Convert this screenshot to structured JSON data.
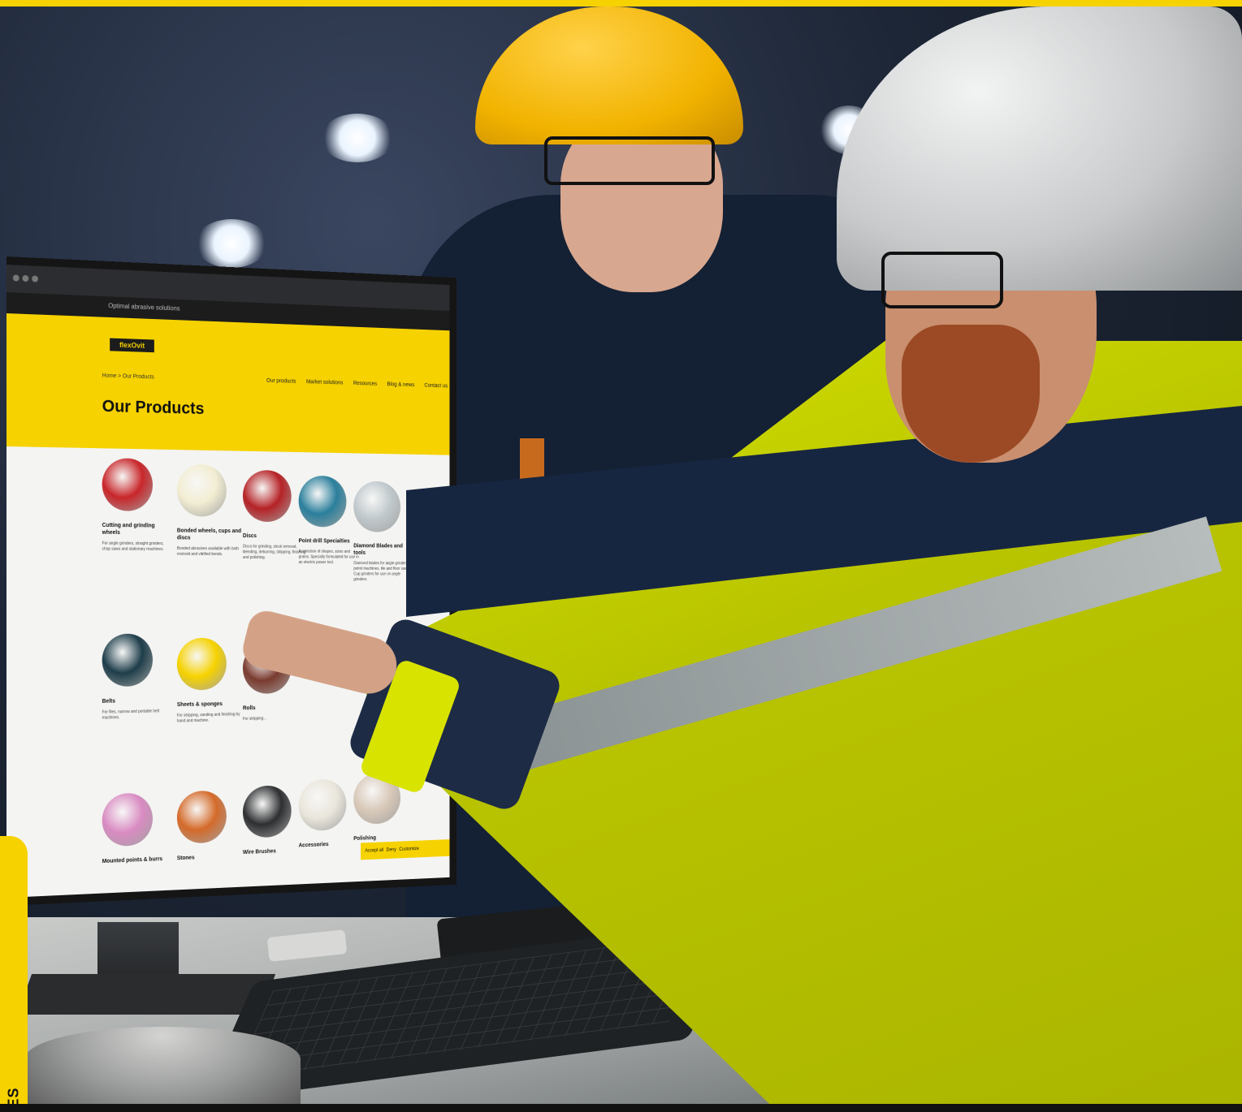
{
  "side_tab": {
    "text": "DES",
    "color": "#f6d200"
  },
  "colors": {
    "brand_yellow": "#f6d200",
    "jacket_navy": "#172640",
    "hi_vis": "#d6e200"
  },
  "screen": {
    "tagline": "Optimal abrasive solutions",
    "logo": "flexOvit",
    "breadcrumb": "Home > Our Products",
    "page_title": "Our Products",
    "nav": [
      "Our products",
      "Market solutions",
      "Resources",
      "Blog & news",
      "Contact us"
    ],
    "products": [
      {
        "name": "Cutting and grinding wheels",
        "desc": "For angle grinders, straight grinders, chop saws and stationary machines.",
        "color": "#c8262a"
      },
      {
        "name": "Bonded wheels, cups and discs",
        "desc": "Bonded abrasives available with both resinoid and vitrified bonds.",
        "color": "#f2edd2"
      },
      {
        "name": "Discs",
        "desc": "Discs for grinding, stock removal, blending, deburring, stripping, finishing and polishing.",
        "color": "#b52226"
      },
      {
        "name": "Point drill Specialties",
        "desc": "A selection of shapes, sizes and grains. Specially formulated for use in an electric power tool.",
        "color": "#2a7f9c"
      },
      {
        "name": "Diamond Blades and tools",
        "desc": "Diamond blades for angle grinders, petrol machines, tile and floor saws. Cup grinders for use on angle grinders.",
        "color": "#c0c8cc"
      },
      {
        "name": "Belts",
        "desc": "For files, narrow and portable belt machines.",
        "color": "#1d3d4a"
      },
      {
        "name": "Sheets & sponges",
        "desc": "For stripping, sanding and finishing by hand and machine.",
        "color": "#f6d200"
      },
      {
        "name": "Rolls",
        "desc": "For stripping...",
        "color": "#7a3b2f"
      },
      {
        "name": "Mounted points & burrs",
        "desc": "",
        "color": "#d98bc2"
      },
      {
        "name": "Stones",
        "desc": "",
        "color": "#d46a2a"
      },
      {
        "name": "Wire Brushes",
        "desc": "",
        "color": "#2d2f31"
      },
      {
        "name": "Accessories",
        "desc": "",
        "color": "#eae6dc"
      },
      {
        "name": "Polishing",
        "desc": "",
        "color": "#d8c8b8"
      }
    ],
    "cookie_buttons": [
      "Accept all",
      "Deny",
      "Customize"
    ]
  }
}
